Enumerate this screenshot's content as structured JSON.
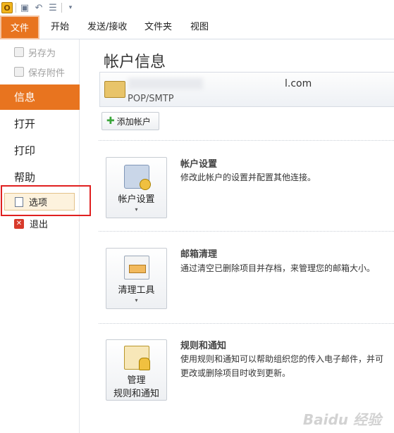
{
  "qat": {
    "app_icon": "outlook-app-icon",
    "buttons": [
      "save-icon",
      "undo-icon",
      "customize-icon"
    ]
  },
  "tabs": [
    {
      "label": "文件",
      "active": true
    },
    {
      "label": "开始"
    },
    {
      "label": "发送/接收"
    },
    {
      "label": "文件夹"
    },
    {
      "label": "视图"
    }
  ],
  "nav": {
    "save_as": "另存为",
    "save_attachments": "保存附件",
    "info": "信息",
    "open": "打开",
    "print": "打印",
    "help": "帮助",
    "options": "选项",
    "exit": "退出"
  },
  "main": {
    "title": "帐户信息",
    "account_email": "l.com",
    "account_type": "POP/SMTP",
    "add_account": "添加帐户",
    "sections": [
      {
        "button_line1": "帐户设置",
        "button_line2": "",
        "title": "帐户设置",
        "desc1": "修改此帐户的设置并配置其他连接。",
        "desc2": ""
      },
      {
        "button_line1": "清理工具",
        "button_line2": "",
        "title": "邮箱清理",
        "desc1": "通过清空已删除项目并存档，来管理您的邮箱大小。",
        "desc2": ""
      },
      {
        "button_line1": "管理",
        "button_line2": "规则和通知",
        "title": "规则和通知",
        "desc1": "使用规则和通知可以帮助组织您的传入电子邮件，并可",
        "desc2": "更改或删除项目时收到更新。"
      }
    ]
  },
  "colors": {
    "accent": "#e8741f",
    "highlight_box": "#e02020"
  },
  "watermark": "Baidu 经验"
}
